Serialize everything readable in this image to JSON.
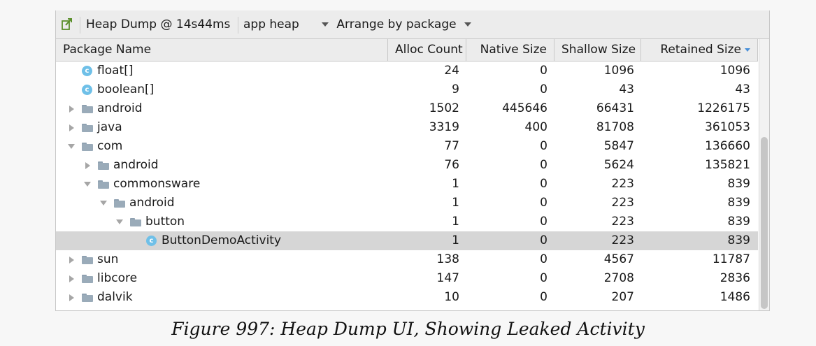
{
  "toolbar": {
    "heap_dump": "Heap Dump @ 14s44ms",
    "heap": "app heap",
    "arrange": "Arrange by package"
  },
  "columns": {
    "package_name": "Package Name",
    "alloc_count": "Alloc Count",
    "native_size": "Native Size",
    "shallow_size": "Shallow Size",
    "retained_size": "Retained Size"
  },
  "rows": [
    {
      "name": "float[]",
      "kind": "class",
      "expander": "none",
      "depth": 0,
      "alloc": "24",
      "native": "0",
      "shallow": "1096",
      "retained": "1096"
    },
    {
      "name": "boolean[]",
      "kind": "class",
      "expander": "none",
      "depth": 0,
      "alloc": "9",
      "native": "0",
      "shallow": "43",
      "retained": "43"
    },
    {
      "name": "android",
      "kind": "package",
      "expander": "collapsed",
      "depth": 0,
      "alloc": "1502",
      "native": "445646",
      "shallow": "66431",
      "retained": "1226175"
    },
    {
      "name": "java",
      "kind": "package",
      "expander": "collapsed",
      "depth": 0,
      "alloc": "3319",
      "native": "400",
      "shallow": "81708",
      "retained": "361053"
    },
    {
      "name": "com",
      "kind": "package",
      "expander": "expanded",
      "depth": 0,
      "alloc": "77",
      "native": "0",
      "shallow": "5847",
      "retained": "136660"
    },
    {
      "name": "android",
      "kind": "package",
      "expander": "collapsed",
      "depth": 1,
      "alloc": "76",
      "native": "0",
      "shallow": "5624",
      "retained": "135821"
    },
    {
      "name": "commonsware",
      "kind": "package",
      "expander": "expanded",
      "depth": 1,
      "alloc": "1",
      "native": "0",
      "shallow": "223",
      "retained": "839"
    },
    {
      "name": "android",
      "kind": "package",
      "expander": "expanded",
      "depth": 2,
      "alloc": "1",
      "native": "0",
      "shallow": "223",
      "retained": "839"
    },
    {
      "name": "button",
      "kind": "package",
      "expander": "expanded",
      "depth": 3,
      "alloc": "1",
      "native": "0",
      "shallow": "223",
      "retained": "839"
    },
    {
      "name": "ButtonDemoActivity",
      "kind": "class",
      "expander": "none",
      "depth": 4,
      "selected": true,
      "alloc": "1",
      "native": "0",
      "shallow": "223",
      "retained": "839"
    },
    {
      "name": "sun",
      "kind": "package",
      "expander": "collapsed",
      "depth": 0,
      "alloc": "138",
      "native": "0",
      "shallow": "4567",
      "retained": "11787"
    },
    {
      "name": "libcore",
      "kind": "package",
      "expander": "collapsed",
      "depth": 0,
      "alloc": "147",
      "native": "0",
      "shallow": "2708",
      "retained": "2836"
    },
    {
      "name": "dalvik",
      "kind": "package",
      "expander": "collapsed",
      "depth": 0,
      "alloc": "10",
      "native": "0",
      "shallow": "207",
      "retained": "1486"
    }
  ],
  "class_icon_letter": "c",
  "caption": "Figure 997: Heap Dump UI, Showing Leaked Activity",
  "colors": {
    "class_icon": "#6fc0e8",
    "sort_indicator": "#4a90d9",
    "selected_row": "#d6d6d6"
  }
}
